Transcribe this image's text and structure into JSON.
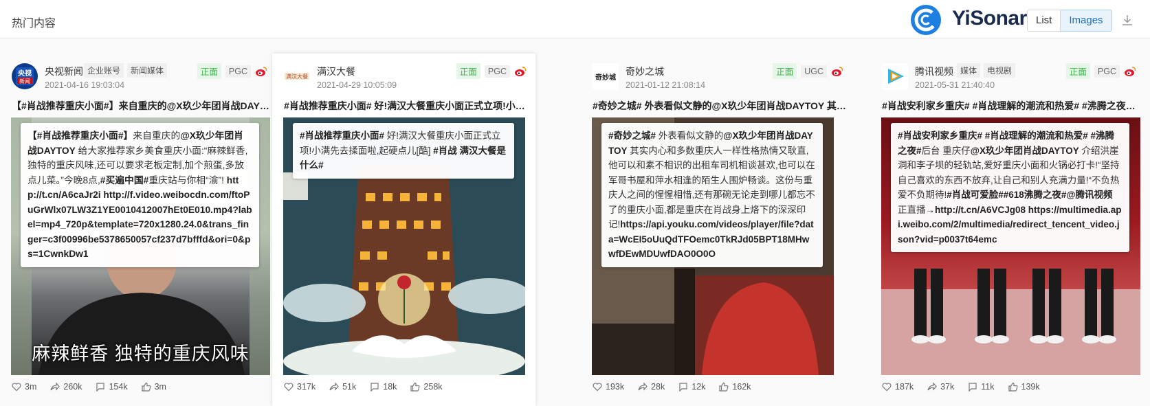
{
  "header": {
    "title": "热门内容",
    "brand": "YiSonar",
    "view_buttons": [
      "List",
      "Images"
    ],
    "active_view": "Images"
  },
  "cards": [
    {
      "account": "央视新闻",
      "avatar_text": "央视 新闻",
      "tags": [
        "企业账号",
        "新闻媒体"
      ],
      "time": "2021-04-16 19:03:04",
      "sentiment": "正面",
      "source_type": "PGC",
      "headline": "【#肖战推荐重庆小面#】来自重庆的@X玖少年团肖战DAYTOY 给大家推荐家乡美食重庆小面",
      "overlay_bold_1": "【#肖战推荐重庆小面#】",
      "overlay_text_1": "来自重庆的",
      "overlay_bold_2": "@X玖少年团肖战DAYTOY",
      "overlay_text_2": " 给大家推荐家乡美食重庆小面:“麻辣鲜香,独特的重庆风味,还可以要求老板定制,加个煎蛋,多放点儿菜。”今晚8点,",
      "overlay_bold_3": "#买遍中国#",
      "overlay_text_3": "重庆站与你相“渝”! ",
      "overlay_link": "http://t.cn/A6caJr2i http://f.video.weibocdn.com/ftoPuGrWlx07LW3Z1YE0010412007hEt0E010.mp4?label=mp4_720p&template=720x1280.24.0&trans_finger=c3f00996be5378650057cf237d7bfffd&ori=0&ps=1CwnkDw1",
      "image_caption": "麻辣鲜香  独特的重庆风味",
      "stats": {
        "likes": "3m",
        "shares": "260k",
        "comments": "154k",
        "thumbs": "3m"
      }
    },
    {
      "account": "满汉大餐",
      "tags": [],
      "time": "2021-04-29 10:05:09",
      "sentiment": "正面",
      "source_type": "PGC",
      "headline": "#肖战推荐重庆小面# 好!满汉大餐重庆小面正式立项!小满先去揉面啦",
      "overlay_bold_1": "#肖战推荐重庆小面#",
      "overlay_text_1": " 好!满汉大餐重庆小面正式立项!小满先去揉面啦,起硬点儿[酷] ",
      "overlay_bold_2": "#肖战 满汉大餐是什么#",
      "stats": {
        "likes": "317k",
        "shares": "51k",
        "comments": "18k",
        "thumbs": "258k"
      }
    },
    {
      "account": "奇妙之城",
      "tags": [],
      "time": "2021-01-12 21:08:14",
      "sentiment": "正面",
      "source_type": "UGC",
      "headline": "#奇妙之城# 外表看似文静的@X玖少年团肖战DAYTOY 其实内心和多数重庆人一样",
      "overlay_bold_1": "#奇妙之城#",
      "overlay_text_1": " 外表看似文静的",
      "overlay_bold_2": "@X玖少年团肖战DAYTOY",
      "overlay_text_2": " 其实内心和多数重庆人一样性格热情又耿直,他可以和素不相识的出租车司机相谈甚欢,也可以在军哥书屋和萍水相逢的陌生人围炉畅谈。这份与重庆人之间的惺惺相惜,还有那碗无论走到哪儿都忘不了的重庆小面,都是重庆在肖战身上烙下的深深印记!",
      "overlay_link": "https://api.youku.com/videos/player/file?data=WcEI5oUuQdTFOemc0TkRJd05BPT18MHwwfDEwMDUwfDAO0O0O",
      "stats": {
        "likes": "193k",
        "shares": "28k",
        "comments": "12k",
        "thumbs": "162k"
      }
    },
    {
      "account": "腾讯视频",
      "tags": [
        "媒体",
        "电视剧"
      ],
      "time": "2021-05-31 21:40:40",
      "sentiment": "正面",
      "source_type": "PGC",
      "headline": "#肖战安利家乡重庆# #肖战理解的潮流和热爱# #沸腾之夜#后台 重庆仔",
      "overlay_bold_1": "#肖战安利家乡重庆# #肖战理解的潮流和热爱# #沸腾之夜#",
      "overlay_text_1": "后台 重庆仔",
      "overlay_bold_2": "@X玖少年团肖战DAYTOY",
      "overlay_text_2": " 介绍洪崖洞和李子坝的轻轨站,爱好重庆小面和火锅必打卡!“坚持自己喜欢的东西不放弃,让自己和别人充满力量!“不负热爱不负期待!",
      "overlay_bold_3": "#肖战可爱脸##618沸腾之夜#@腾讯视频",
      "overlay_text_3": " 正直播",
      "overlay_link": "→http://t.cn/A6VCJg08 https://multimedia.api.weibo.com/2/multimedia/redirect_tencent_video.json?vid=p0037t64emc",
      "stats": {
        "likes": "187k",
        "shares": "37k",
        "comments": "11k",
        "thumbs": "139k"
      }
    }
  ],
  "colors": {
    "brand_blue": "#1d7fe0",
    "positive_green": "#3bb04a",
    "weibo_red": "#e6162d"
  }
}
